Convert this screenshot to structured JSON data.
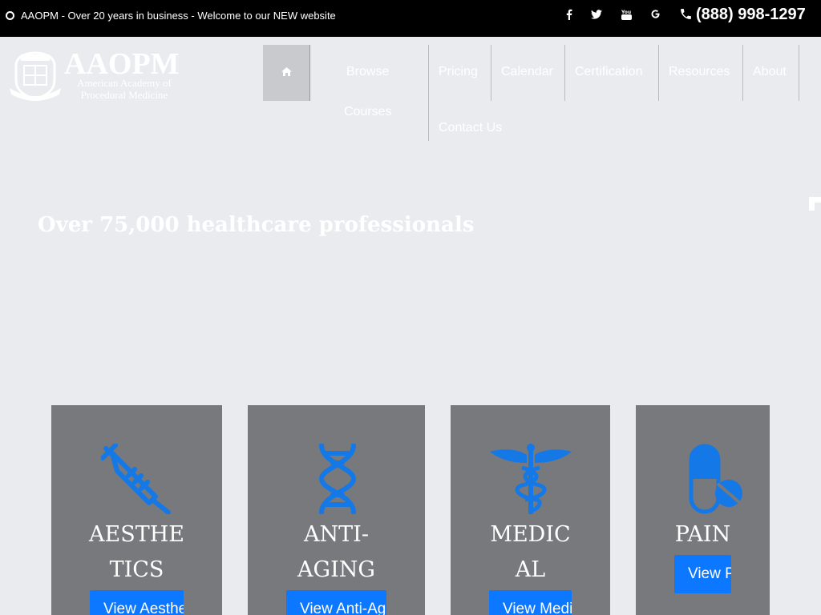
{
  "topbar": {
    "message": "AAOPM - Over 20 years in business - Welcome to our NEW website",
    "social": [
      {
        "name": "facebook-icon",
        "glyph": "f"
      },
      {
        "name": "twitter-icon",
        "glyph": "t"
      },
      {
        "name": "youtube-icon",
        "glyph": "yt"
      },
      {
        "name": "google-icon",
        "glyph": "G"
      }
    ],
    "phone": "(888) 998-1297"
  },
  "logo": {
    "wordmark": "AAOPM",
    "line1": "American Academy of",
    "line2": "Procedural Medicine"
  },
  "nav": {
    "home_icon": "home-icon",
    "browse_line1": "Browse",
    "browse_line2": "Courses",
    "pricing": "Pricing",
    "calendar": "Calendar",
    "certification": "Certification",
    "resources": "Resources",
    "about": "About",
    "contact": "Contact Us"
  },
  "hero": {
    "title": "Over 75,000 healthcare professionals"
  },
  "cards": [
    {
      "title_line1": "AESTHE",
      "title_line2": "TICS",
      "button": "View Aesthetics",
      "icon": "syringe-icon"
    },
    {
      "title_line1": "ANTI-",
      "title_line2": "AGING",
      "button": "View Anti-Aging",
      "icon": "dna-icon"
    },
    {
      "title_line1": "MEDIC",
      "title_line2": "AL",
      "button": "View Medical",
      "icon": "caduceus-icon"
    },
    {
      "title_line1": "PAIN",
      "title_line2": "",
      "button": "View Pain",
      "icon": "pill-icon"
    }
  ],
  "colors": {
    "accent": "#0c78ff",
    "card_bg": "#77797d",
    "page_bg": "#eaebef",
    "topbar_bg": "#000000"
  }
}
